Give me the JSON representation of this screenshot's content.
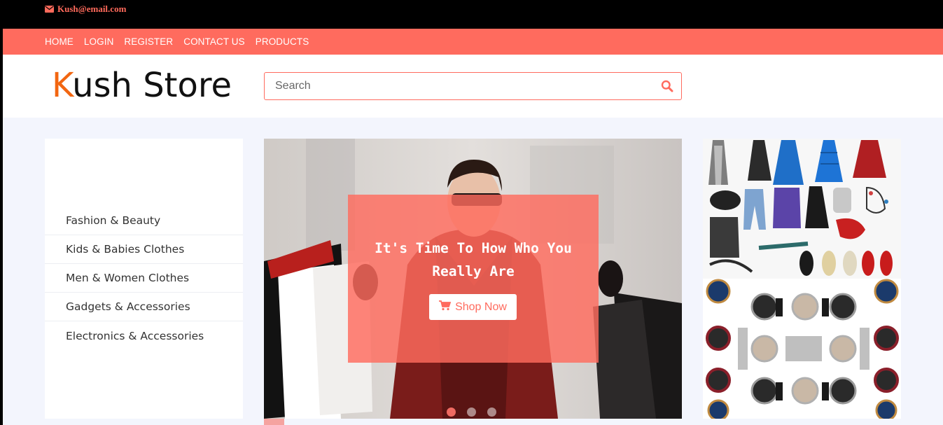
{
  "topbar": {
    "email": "Kush@email.com",
    "icon": "envelope-icon"
  },
  "nav": {
    "items": [
      "HOME",
      "LOGIN",
      "REGISTER",
      "CONTACT US",
      "PRODUCTS"
    ]
  },
  "header": {
    "logo_first": "K",
    "logo_rest": "ush Store",
    "search_placeholder": "Search",
    "search_icon": "search-icon"
  },
  "sidebar": {
    "categories": [
      "Fashion & Beauty",
      "Kids & Babies Clothes",
      "Men & Women Clothes",
      "Gadgets & Accessories",
      "Electronics & Accessories"
    ]
  },
  "hero": {
    "headline_line1": "It's Time To How Who You",
    "headline_line2": "Really Are",
    "button_label": "Shop Now",
    "button_icon": "shopping-cart-icon",
    "slide_count": 3,
    "active_slide": 1
  },
  "colors": {
    "accent": "#ff6b5e",
    "logo_accent": "#f26611",
    "topbar": "#000000",
    "page_bg": "#f3f5fd"
  }
}
